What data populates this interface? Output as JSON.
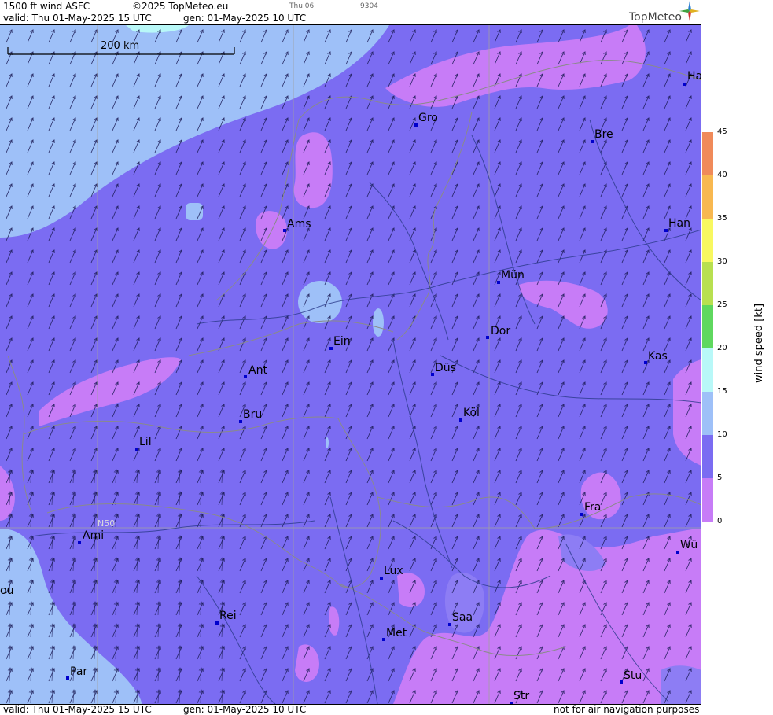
{
  "header": {
    "title": "1500 ft wind ASFC",
    "copyright": "©2025 TopMeteo.eu",
    "day_small": "Thu 06",
    "code_small": "9304",
    "valid": "valid:  Thu  01-May-2025  15 UTC",
    "gen": "gen: 01-May-2025 10 UTC",
    "logo": "TopMeteo"
  },
  "footer": {
    "valid": "valid:  Thu  01-May-2025  15 UTC",
    "gen": "gen: 01-May-2025 10 UTC",
    "disclaimer": "not for air navigation purposes"
  },
  "scale_label": "200 km",
  "grid_label": "N50",
  "legend": {
    "title": "wind  speed  [kt]",
    "ticks": [
      "0",
      "5",
      "10",
      "15",
      "20",
      "25",
      "30",
      "35",
      "40",
      "45"
    ],
    "colors": [
      "#c77cf7",
      "#7b6cf2",
      "#9ec0f8",
      "#b8f8f8",
      "#5fd85f",
      "#b8e050",
      "#f8f860",
      "#f8b850",
      "#f08a5a"
    ]
  },
  "colors": {
    "base": "#7b6cf2",
    "light": "#9ec0f8",
    "cyan": "#b8f8f8",
    "violet": "#c77cf7",
    "blue_mid": "#8d7df4"
  },
  "cities": [
    {
      "name": "Gro"
    },
    {
      "name": "Bre"
    },
    {
      "name": "Ha"
    },
    {
      "name": "Ams"
    },
    {
      "name": "Han"
    },
    {
      "name": "Mün"
    },
    {
      "name": "Dor"
    },
    {
      "name": "Ein"
    },
    {
      "name": "Kas"
    },
    {
      "name": "Ant"
    },
    {
      "name": "Düs"
    },
    {
      "name": "Bru"
    },
    {
      "name": "Köl"
    },
    {
      "name": "Lil"
    },
    {
      "name": "Fra"
    },
    {
      "name": "Ami"
    },
    {
      "name": "Wü"
    },
    {
      "name": "ou"
    },
    {
      "name": "Lux"
    },
    {
      "name": "Rei"
    },
    {
      "name": "Saa"
    },
    {
      "name": "Met"
    },
    {
      "name": "Par"
    },
    {
      "name": "Stu"
    },
    {
      "name": "Str"
    }
  ]
}
